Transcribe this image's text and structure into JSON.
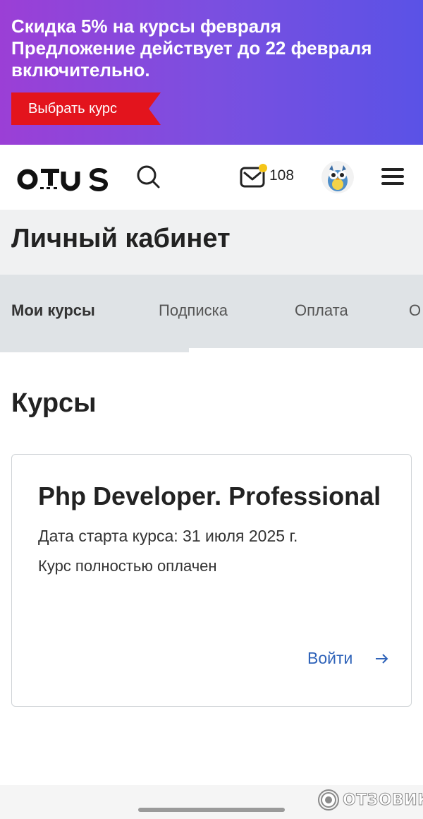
{
  "promo": {
    "line1": "Скидка 5% на курсы февраля",
    "line2": "Предложение действует до 22 февраля",
    "line3": "включительно.",
    "button_label": "Выбрать курс"
  },
  "header": {
    "logo_text": "otus",
    "messages_count": "108"
  },
  "page": {
    "title": "Личный кабинет"
  },
  "tabs": [
    {
      "label": "Мои курсы",
      "active": true
    },
    {
      "label": "Подписка",
      "active": false
    },
    {
      "label": "Оплата",
      "active": false
    },
    {
      "label": "О",
      "active": false
    }
  ],
  "courses": {
    "section_title": "Курсы",
    "items": [
      {
        "title": "Php Developer. Professional",
        "start_date": "Дата старта курса: 31 июля 2025 г.",
        "status": "Курс полностью оплачен",
        "action_label": "Войти"
      }
    ]
  },
  "watermark": {
    "text": "ОТЗОВИК"
  },
  "colors": {
    "banner_gradient_start": "#9b3fd6",
    "banner_gradient_end": "#5a52e6",
    "promo_button": "#e3141d",
    "link": "#2f63b9",
    "notification_dot": "#f5c518"
  }
}
